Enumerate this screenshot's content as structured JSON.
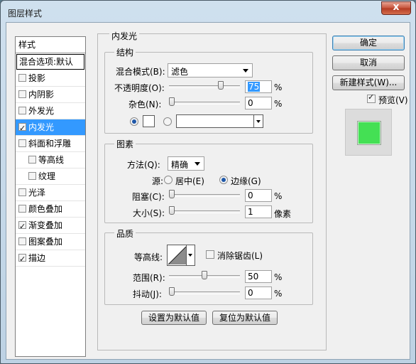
{
  "window": {
    "title": "图层样式",
    "close_glyph": "x"
  },
  "sidebar": {
    "header": "样式",
    "blend_options": "混合选项:默认",
    "items": [
      {
        "label": "投影",
        "checked": false,
        "indent": 0
      },
      {
        "label": "内阴影",
        "checked": false,
        "indent": 0
      },
      {
        "label": "外发光",
        "checked": false,
        "indent": 0
      },
      {
        "label": "内发光",
        "checked": true,
        "indent": 0,
        "selected": true
      },
      {
        "label": "斜面和浮雕",
        "checked": false,
        "indent": 0
      },
      {
        "label": "等高线",
        "checked": false,
        "indent": 1
      },
      {
        "label": "纹理",
        "checked": false,
        "indent": 1
      },
      {
        "label": "光泽",
        "checked": false,
        "indent": 0
      },
      {
        "label": "颜色叠加",
        "checked": false,
        "indent": 0
      },
      {
        "label": "渐变叠加",
        "checked": true,
        "indent": 0
      },
      {
        "label": "图案叠加",
        "checked": false,
        "indent": 0
      },
      {
        "label": "描边",
        "checked": true,
        "indent": 0
      }
    ]
  },
  "panel": {
    "title": "内发光",
    "structure": {
      "title": "结构",
      "blend_mode_label": "混合模式(B):",
      "blend_mode_value": "滤色",
      "opacity_label": "不透明度(O):",
      "opacity_value": "75",
      "opacity_unit": "%",
      "opacity_level": 0.75,
      "noise_label": "杂色(N):",
      "noise_value": "0",
      "noise_unit": "%",
      "noise_level": 0
    },
    "elements": {
      "title": "图素",
      "method_label": "方法(Q):",
      "method_value": "精确",
      "source_label": "源:",
      "source_center": "居中(E)",
      "source_edge": "边缘(G)",
      "choke_label": "阻塞(C):",
      "choke_value": "0",
      "choke_unit": "%",
      "choke_level": 0,
      "size_label": "大小(S):",
      "size_value": "1",
      "size_unit": "像素",
      "size_level": 0.004
    },
    "quality": {
      "title": "品质",
      "contour_label": "等高线:",
      "anti_alias_label": "消除锯齿(L)",
      "range_label": "范围(R):",
      "range_value": "50",
      "range_unit": "%",
      "range_level": 0.5,
      "jitter_label": "抖动(J):",
      "jitter_value": "0",
      "jitter_unit": "%",
      "jitter_level": 0
    },
    "set_default": "设置为默认值",
    "reset_default": "复位为默认值"
  },
  "buttons": {
    "ok": "确定",
    "cancel": "取消",
    "new_style": "新建样式(W)...",
    "preview_label": "预览(V)"
  },
  "colors": {
    "preview_fill": "#44e054",
    "selection": "#3399ff"
  }
}
